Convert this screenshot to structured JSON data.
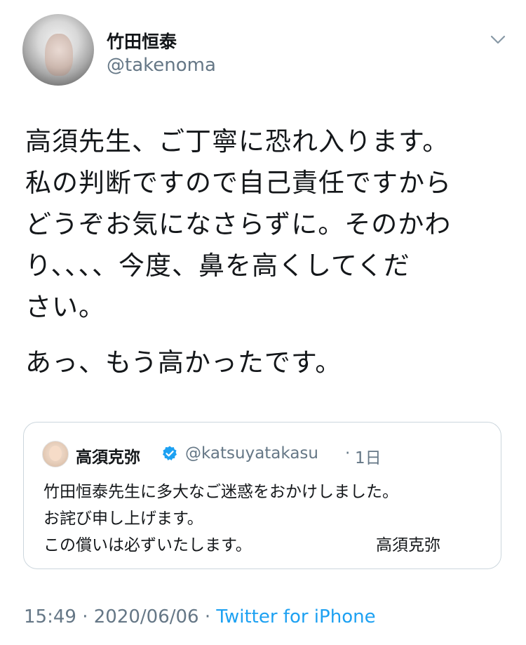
{
  "user": {
    "name": "竹田恒泰",
    "handle": "@takenoma"
  },
  "tweet": {
    "lines": [
      "高須先生、ご丁寧に恐れ入ります。",
      "私の判断ですので自己責任ですから",
      "どうぞお気になさらずに。そのかわ",
      "り、、、、今度、鼻を高くしてくだ",
      "さい。"
    ],
    "paragraph2": "あっ、もう高かったです。"
  },
  "quoted_tweet": {
    "name": "高須克弥",
    "handle": "@katsuyatakasu",
    "separator": "·",
    "time": "1日",
    "lines": [
      "竹田恒泰先生に多大なご迷惑をおかけしました。",
      "お詫び申し上げます。",
      "この償いは必ずいたします。"
    ],
    "signature": "高須克弥"
  },
  "footer": {
    "time": "15:49",
    "sep1": " · ",
    "date": "2020/06/06",
    "sep2": " · ",
    "source": "Twitter for iPhone"
  },
  "colors": {
    "text": "#14171a",
    "secondary": "#657786",
    "link": "#1da1f2",
    "border": "#ccd6dd"
  },
  "icons": {
    "caret": "chevron-down-icon",
    "verified": "verified-badge-icon"
  }
}
